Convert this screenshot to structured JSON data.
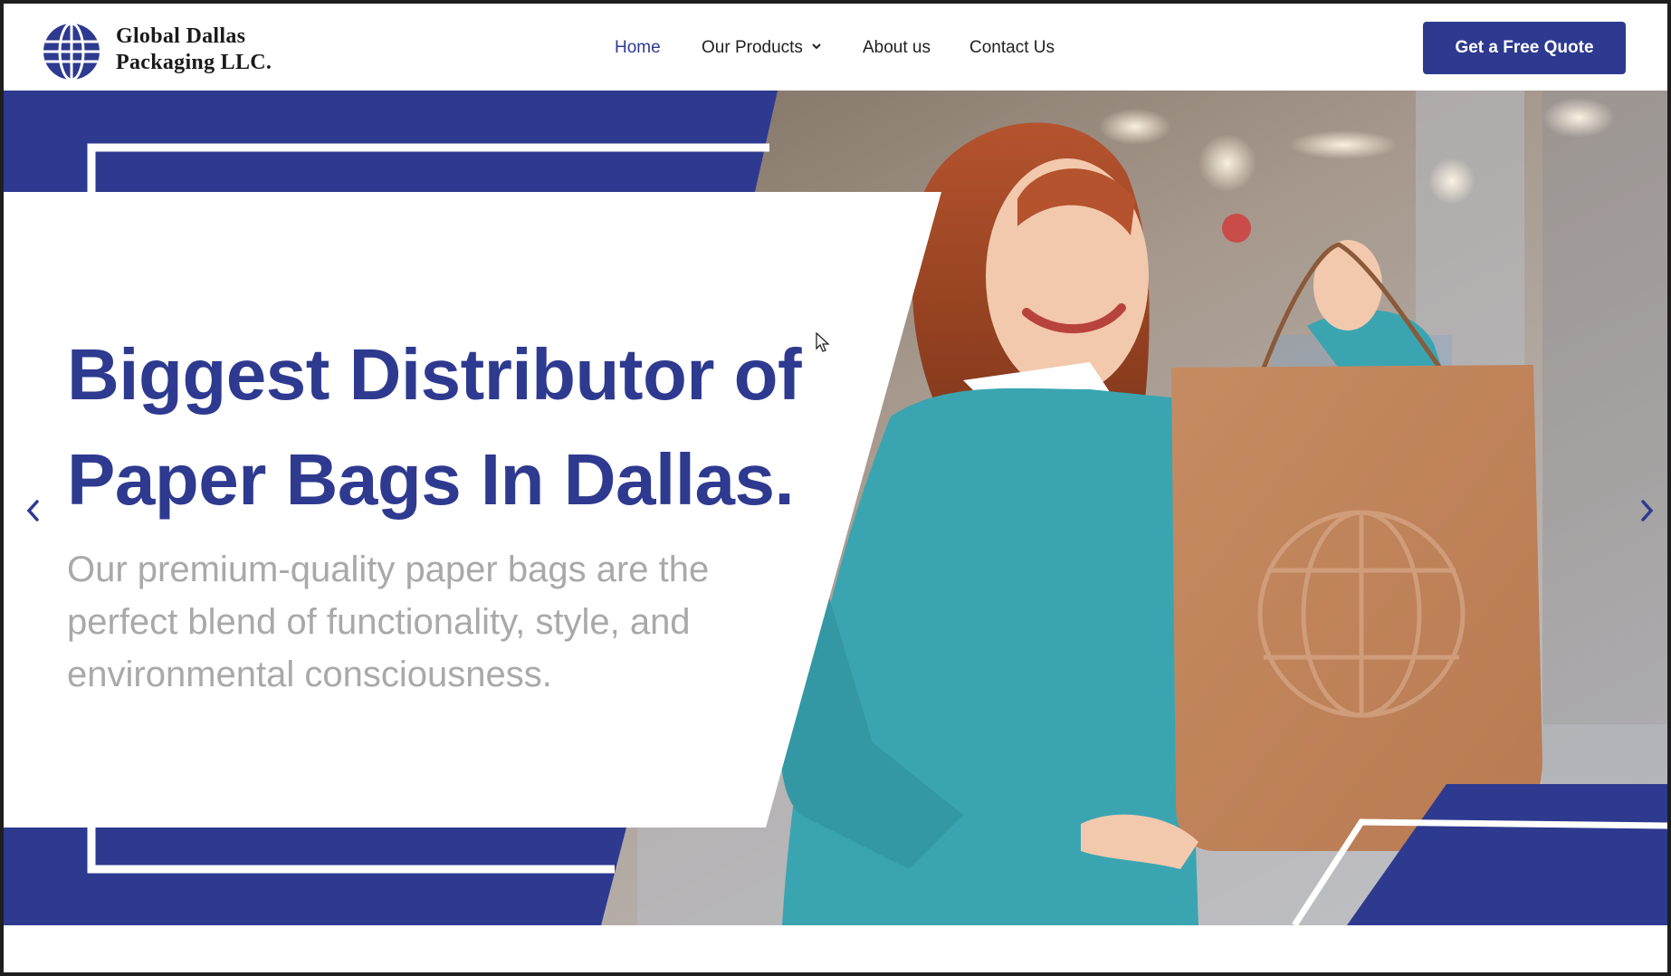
{
  "brand": {
    "name_line1": "Global Dallas",
    "name_line2": "Packaging LLC.",
    "logo_icon": "globe-icon",
    "color": "#2e3a8f"
  },
  "nav": {
    "items": [
      {
        "label": "Home",
        "active": true
      },
      {
        "label": "Our Products",
        "has_dropdown": true
      },
      {
        "label": "About us"
      },
      {
        "label": "Contact Us"
      }
    ]
  },
  "cta": {
    "label": "Get a Free Quote"
  },
  "hero": {
    "headline_line1": "Biggest Distributor of",
    "headline_line2": "Paper Bags In Dallas.",
    "subtext": "Our premium-quality paper bags are the perfect blend of functionality, style, and environmental consciousness.",
    "prev_icon": "chevron-left-icon",
    "next_icon": "chevron-right-icon"
  },
  "colors": {
    "accent": "#2e3a8f",
    "subtext": "#a9a9a9",
    "kraft": "#c89068",
    "sweater": "#3aa5b1"
  }
}
